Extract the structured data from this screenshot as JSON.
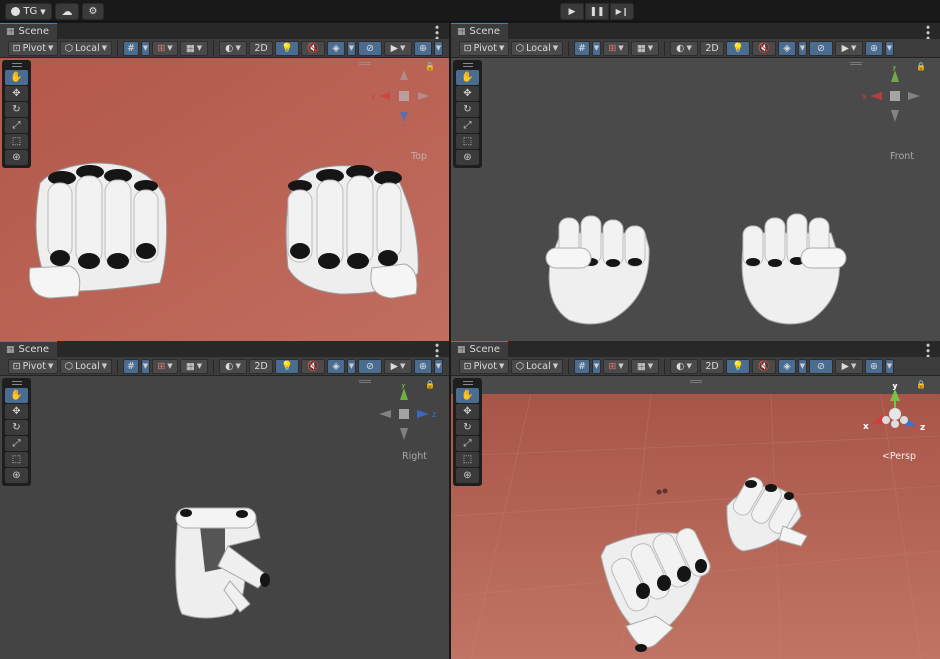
{
  "topbar": {
    "account_label": "TG",
    "icons": [
      "account-icon",
      "cloud-icon",
      "services-icon"
    ],
    "playback": [
      "play-icon",
      "pause-icon",
      "step-icon"
    ]
  },
  "panes": [
    {
      "tab": "Scene",
      "view_label": "Top",
      "background": "#b5604f",
      "pivot": "Pivot",
      "space": "Local",
      "mode2d": "2D"
    },
    {
      "tab": "Scene",
      "view_label": "Front",
      "background": "#4a4a4a",
      "pivot": "Pivot",
      "space": "Local",
      "mode2d": "2D"
    },
    {
      "tab": "Scene",
      "view_label": "Right",
      "background": "#444444",
      "pivot": "Pivot",
      "space": "Local",
      "mode2d": "2D"
    },
    {
      "tab": "Scene",
      "view_label": "<Persp",
      "background": "#b4675b",
      "pivot": "Pivot",
      "space": "Local",
      "mode2d": "2D"
    }
  ],
  "axes": {
    "x": "x",
    "y": "y",
    "z": "z"
  },
  "colors": {
    "x_axis": "#d23c3c",
    "y_axis": "#7ac146",
    "z_axis": "#3b6fd0",
    "selection": "#4b6c91"
  }
}
